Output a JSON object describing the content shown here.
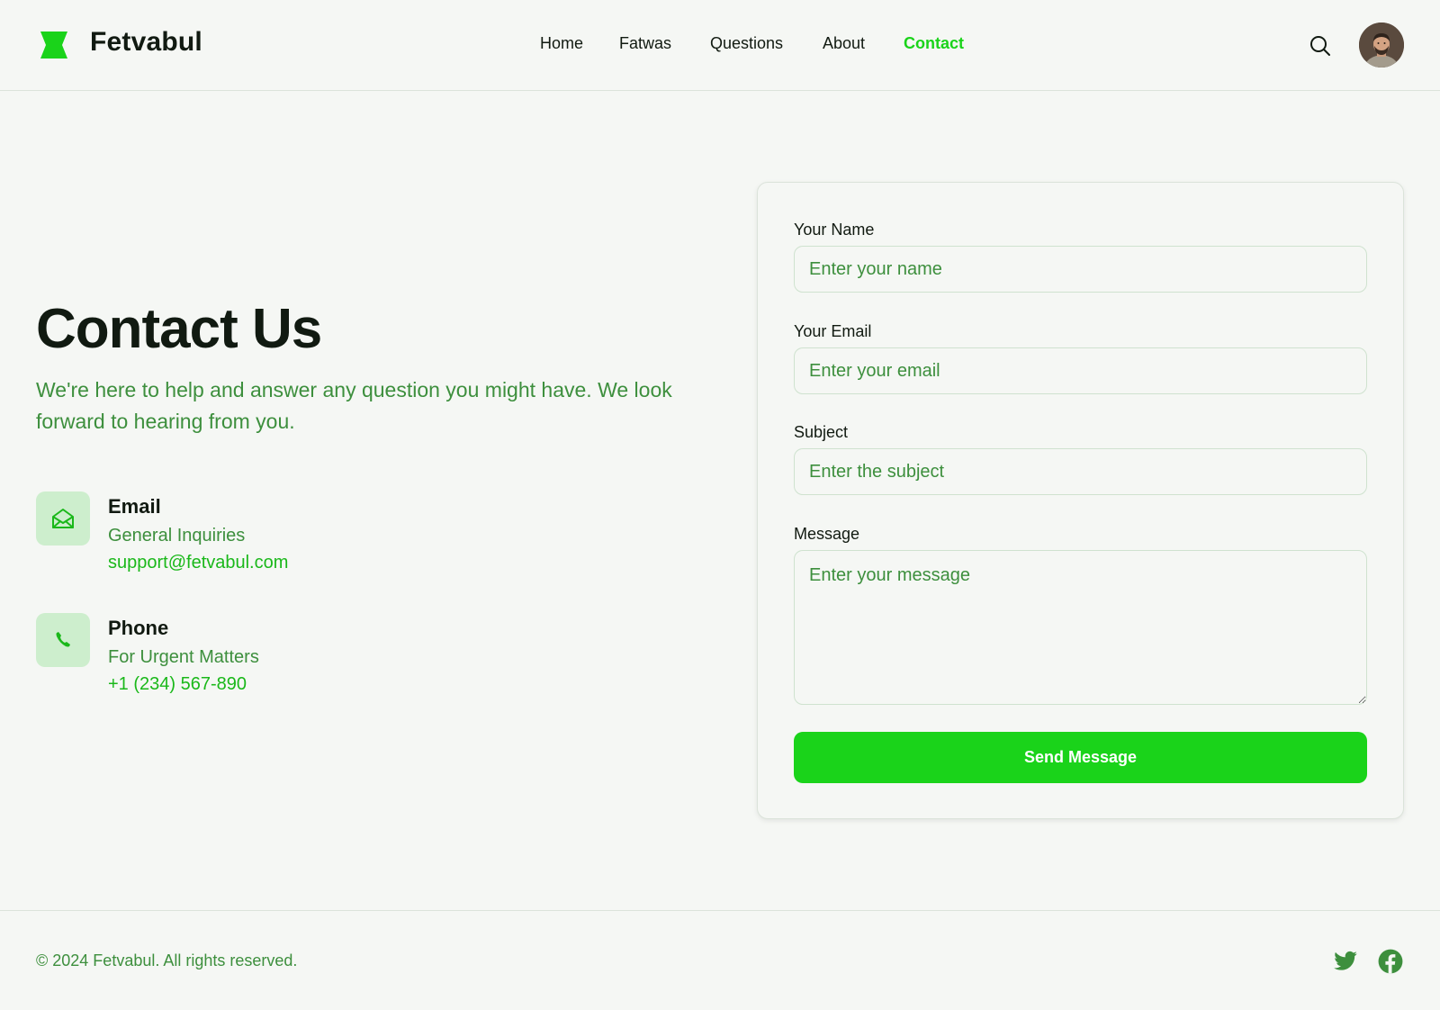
{
  "header": {
    "brand": "Fetvabul",
    "nav": [
      {
        "label": "Home"
      },
      {
        "label": "Fatwas"
      },
      {
        "label": "Questions"
      },
      {
        "label": "About"
      },
      {
        "label": "Contact",
        "active": true
      }
    ],
    "search_icon": "search-icon",
    "avatar_icon": "user-avatar"
  },
  "hero": {
    "title": "Contact Us",
    "intro": "We're here to help and answer any question you might have. We look forward to hearing from you."
  },
  "contacts": [
    {
      "icon": "mail-open-icon",
      "heading": "Email",
      "sub": "General Inquiries",
      "value": "support@fetvabul.com"
    },
    {
      "icon": "phone-icon",
      "heading": "Phone",
      "sub": "For Urgent Matters",
      "value": "+1 (234) 567-890"
    }
  ],
  "form": {
    "name": {
      "label": "Your Name",
      "placeholder": "Enter your name",
      "value": ""
    },
    "email": {
      "label": "Your Email",
      "placeholder": "Enter your email",
      "value": ""
    },
    "subject": {
      "label": "Subject",
      "placeholder": "Enter the subject",
      "value": ""
    },
    "message": {
      "label": "Message",
      "placeholder": "Enter your message",
      "value": ""
    },
    "submit_label": "Send Message"
  },
  "footer": {
    "copyright": "© 2024 Fetvabul. All rights reserved.",
    "social": [
      "twitter-icon",
      "facebook-icon"
    ]
  },
  "colors": {
    "accent": "#1ad31a",
    "muted_text": "#3d8f3d",
    "background": "#f5f7f4",
    "icon_tile": "#cdeecd"
  }
}
